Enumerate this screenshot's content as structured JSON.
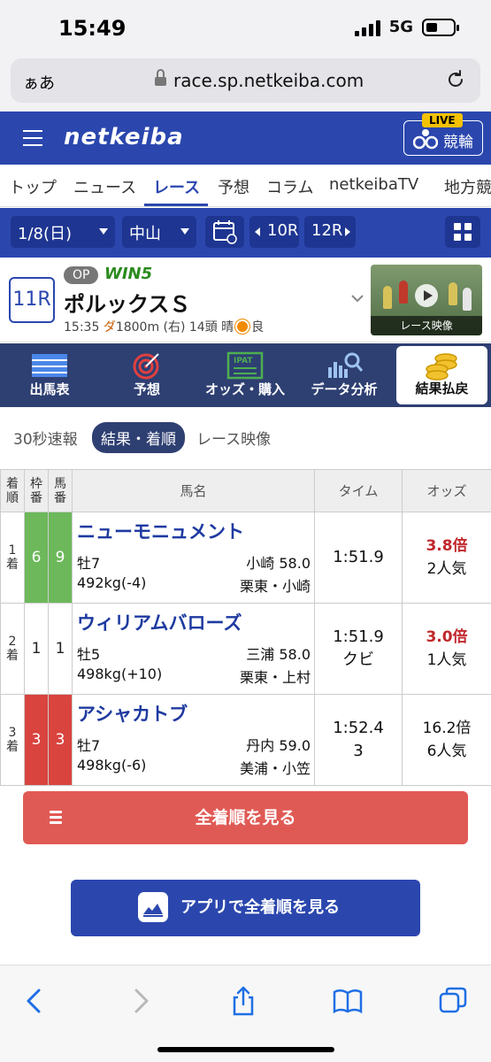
{
  "status": {
    "time": "15:49",
    "network": "5G"
  },
  "browser": {
    "aa_label": "ぁあ",
    "url": "race.sp.netkeiba.com"
  },
  "header": {
    "logo": "netkeiba",
    "live_badge": "LIVE",
    "live_label": "競輪"
  },
  "nav": {
    "items": [
      "トップ",
      "ニュース",
      "レース",
      "予想",
      "コラム",
      "netkeibaTV",
      "地方競"
    ],
    "active_index": 2
  },
  "filters": {
    "date": "1/8(日)",
    "venue": "中山",
    "prev_race": "10R",
    "next_race": "12R"
  },
  "race": {
    "number": "11R",
    "grade": "OP",
    "win5": "WIN5",
    "name": "ポルックスＳ",
    "time": "15:35",
    "surface": "ダ",
    "distance": "1800m (右) 14頭 晴",
    "condition": "良",
    "video_caption": "レース映像"
  },
  "feature_tabs": [
    "出馬表",
    "予想",
    "オッズ・購入",
    "データ分析",
    "結果払戻"
  ],
  "feature_tab_icons": [
    "table-icon",
    "target-icon",
    "ipat-icon",
    "chart-search-icon",
    "coins-icon"
  ],
  "feature_tabs_active": 4,
  "sub_tabs": [
    "30秒速報",
    "結果・着順",
    "レース映像"
  ],
  "sub_tabs_active": 1,
  "table": {
    "headers": {
      "rank": "着順",
      "waku": "枠番",
      "umaban": "馬番",
      "name": "馬名",
      "time": "タイム",
      "odds": "オッズ"
    },
    "rows": [
      {
        "rank": "1着",
        "waku": "6",
        "umaban": "9",
        "waku_color": "#6cb85a",
        "name": "ニューモニュメント",
        "sex_age": "牡7",
        "jockey": "小崎 58.0",
        "weight": "492kg(-4)",
        "trainer": "栗東・小崎",
        "time": "1:51.9",
        "margin": "",
        "odds": "3.8倍",
        "odds_red": true,
        "pop": "2人気"
      },
      {
        "rank": "2着",
        "waku": "1",
        "umaban": "1",
        "waku_color": "#ffffff",
        "name": "ウィリアムバローズ",
        "sex_age": "牡5",
        "jockey": "三浦 58.0",
        "weight": "498kg(+10)",
        "trainer": "栗東・上村",
        "time": "1:51.9",
        "margin": "クビ",
        "odds": "3.0倍",
        "odds_red": true,
        "pop": "1人気"
      },
      {
        "rank": "3着",
        "waku": "3",
        "umaban": "3",
        "waku_color": "#d9443f",
        "name": "アシャカトブ",
        "sex_age": "牡7",
        "jockey": "丹内 59.0",
        "weight": "498kg(-6)",
        "trainer": "美浦・小笠",
        "time": "1:52.4",
        "margin": "3",
        "odds": "16.2倍",
        "odds_red": false,
        "pop": "6人気"
      }
    ]
  },
  "buttons": {
    "full_results": "全着順を見る",
    "app_results": "アプリで全着順を見る"
  },
  "colors": {
    "brand_blue": "#2b47ae",
    "dark_navy": "#2e3f72",
    "red_button": "#e05a55",
    "odds_red": "#c0282c"
  }
}
